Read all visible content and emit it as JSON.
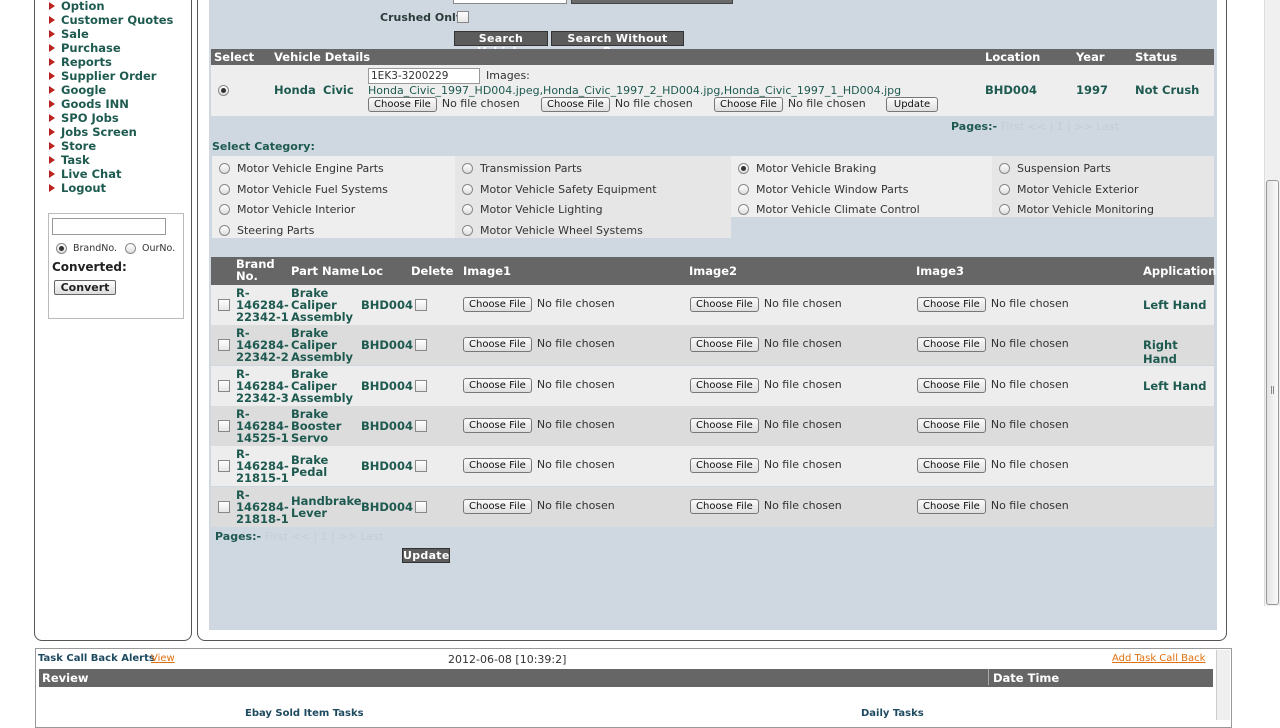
{
  "sidebar": {
    "items": [
      {
        "label": "Option"
      },
      {
        "label": "Customer Quotes"
      },
      {
        "label": "Sale"
      },
      {
        "label": "Purchase"
      },
      {
        "label": "Reports"
      },
      {
        "label": "Supplier Order"
      },
      {
        "label": "Google"
      },
      {
        "label": "Goods INN"
      },
      {
        "label": "SPO Jobs"
      },
      {
        "label": "Jobs Screen"
      },
      {
        "label": "Store"
      },
      {
        "label": "Task"
      },
      {
        "label": "Live Chat"
      },
      {
        "label": "Logout"
      }
    ],
    "converter": {
      "input_value": "",
      "radio_brand": "BrandNo.",
      "radio_our": "OurNo.",
      "selected": "BrandNo.",
      "label": "Converted:",
      "button": "Convert"
    }
  },
  "search": {
    "crushed_label": "Crushed Only",
    "crushed_checked": false,
    "search_vehicle_button": "Search Vehicle",
    "search_noreg_button": "Search Without Reg."
  },
  "vehicle_table": {
    "headers": {
      "select": "Select",
      "details": "Vehicle Details",
      "location": "Location",
      "year": "Year",
      "status": "Status"
    },
    "row": {
      "make": "Honda",
      "model": "Civic",
      "reg": "1EK3-3200229",
      "images_label": "Images:",
      "images_files": "Honda_Civic_1997_HD004.jpeg,Honda_Civic_1997_2_HD004.jpg,Honda_Civic_1997_1_HD004.jpg",
      "choose_file": "Choose File",
      "no_file": "No file chosen",
      "update": "Update",
      "location": "BHD004",
      "year": "1997",
      "status": "Not Crush"
    },
    "pages_label": "Pages:-",
    "pages_nav": "First << | 1 | >> Last"
  },
  "categories": {
    "label": "Select Category:",
    "items": [
      {
        "label": "Motor Vehicle Engine Parts",
        "selected": false
      },
      {
        "label": "Motor Vehicle Fuel Systems",
        "selected": false
      },
      {
        "label": "Motor Vehicle Interior",
        "selected": false
      },
      {
        "label": "Steering Parts",
        "selected": false
      },
      {
        "label": "Transmission Parts",
        "selected": false
      },
      {
        "label": "Motor Vehicle Safety Equipment",
        "selected": false
      },
      {
        "label": "Motor Vehicle Lighting",
        "selected": false
      },
      {
        "label": "Motor Vehicle Wheel Systems",
        "selected": false
      },
      {
        "label": "Motor Vehicle Braking",
        "selected": true
      },
      {
        "label": "Motor Vehicle Window Parts",
        "selected": false
      },
      {
        "label": "Motor Vehicle Climate Control",
        "selected": false
      },
      {
        "label": "Suspension Parts",
        "selected": false
      },
      {
        "label": "Motor Vehicle Exterior",
        "selected": false
      },
      {
        "label": "Motor Vehicle Monitoring",
        "selected": false
      }
    ]
  },
  "parts_table": {
    "headers": {
      "brand_no_1": "Brand",
      "brand_no_2": "No.",
      "part_name": "Part Name",
      "loc": "Loc",
      "delete": "Delete",
      "image1": "Image1",
      "image2": "Image2",
      "image3": "Image3",
      "application": "Application"
    },
    "choose_file": "Choose File",
    "no_file": "No file chosen",
    "rows": [
      {
        "brand_no": [
          "R-",
          "146284-",
          "22342-1"
        ],
        "part_name": [
          "Brake",
          "Caliper",
          "Assembly"
        ],
        "loc": "BHD004",
        "application": "Left Hand"
      },
      {
        "brand_no": [
          "R-",
          "146284-",
          "22342-2"
        ],
        "part_name": [
          "Brake",
          "Caliper",
          "Assembly"
        ],
        "loc": "BHD004",
        "application": "Right Hand"
      },
      {
        "brand_no": [
          "R-",
          "146284-",
          "22342-3"
        ],
        "part_name": [
          "Brake",
          "Caliper",
          "Assembly"
        ],
        "loc": "BHD004",
        "application": "Left Hand"
      },
      {
        "brand_no": [
          "R-",
          "146284-",
          "14525-1"
        ],
        "part_name": [
          "Brake",
          "Booster",
          "Servo"
        ],
        "loc": "BHD004",
        "application": ""
      },
      {
        "brand_no": [
          "R-",
          "146284-",
          "21815-1"
        ],
        "part_name": [
          "Brake",
          "Pedal"
        ],
        "loc": "BHD004",
        "application": ""
      },
      {
        "brand_no": [
          "R-",
          "146284-",
          "21818-1"
        ],
        "part_name": [
          "Handbrake",
          "Lever"
        ],
        "loc": "BHD004",
        "application": ""
      }
    ],
    "pages_label": "Pages:-",
    "pages_nav": "First << | 1 | >> Last",
    "update_button": "Update"
  },
  "bottom": {
    "alerts_title": "Task Call Back Alerts",
    "alerts_view": "View",
    "datetime": "2012-06-08 [10:39:2]",
    "add_callback": "Add Task Call Back",
    "review_header": "Review",
    "datetime_header": "Date Time",
    "ebay_tasks": "Ebay Sold Item Tasks",
    "daily_tasks": "Daily Tasks"
  }
}
